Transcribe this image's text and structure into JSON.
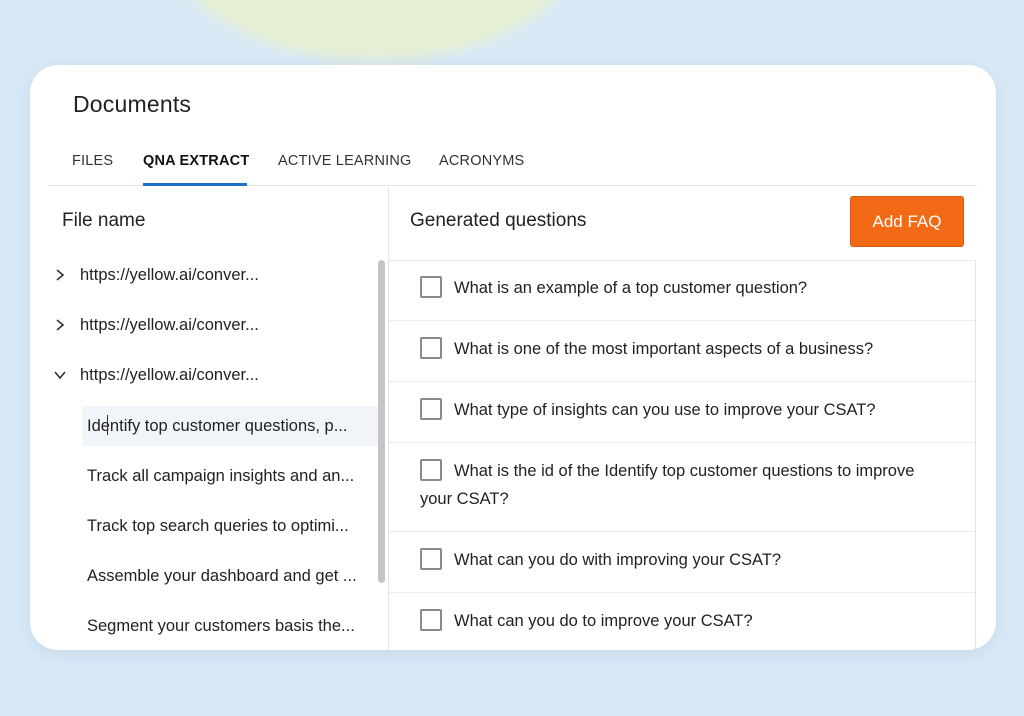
{
  "page": {
    "title": "Documents"
  },
  "tabs": [
    {
      "label": "FILES",
      "active": false
    },
    {
      "label": "QNA EXTRACT",
      "active": true
    },
    {
      "label": "ACTIVE LEARNING",
      "active": false
    },
    {
      "label": "ACRONYMS",
      "active": false
    }
  ],
  "files": {
    "header": "File name",
    "items": [
      {
        "label": "https://yellow.ai/conver...",
        "expanded": false
      },
      {
        "label": "https://yellow.ai/conver...",
        "expanded": false
      },
      {
        "label": "https://yellow.ai/conver...",
        "expanded": true
      }
    ],
    "subitems": [
      "Identify top customer questions, p...",
      "Track all campaign insights and an...",
      "Track top search queries to optimi...",
      "Assemble your dashboard and get ...",
      "Segment your customers basis the..."
    ]
  },
  "questions": {
    "header": "Generated questions",
    "add_label": "Add FAQ",
    "items": [
      "What is an example of a top customer question?",
      "What is one of the most important aspects of a business?",
      "What type of insights can you use to improve your CSAT?",
      "What is the id of the Identify top customer questions to improve your CSAT?",
      "What can you do with improving your CSAT?",
      "What can you do to improve your CSAT?"
    ]
  },
  "colors": {
    "accent": "#1a73c9",
    "button": "#f26a16"
  }
}
